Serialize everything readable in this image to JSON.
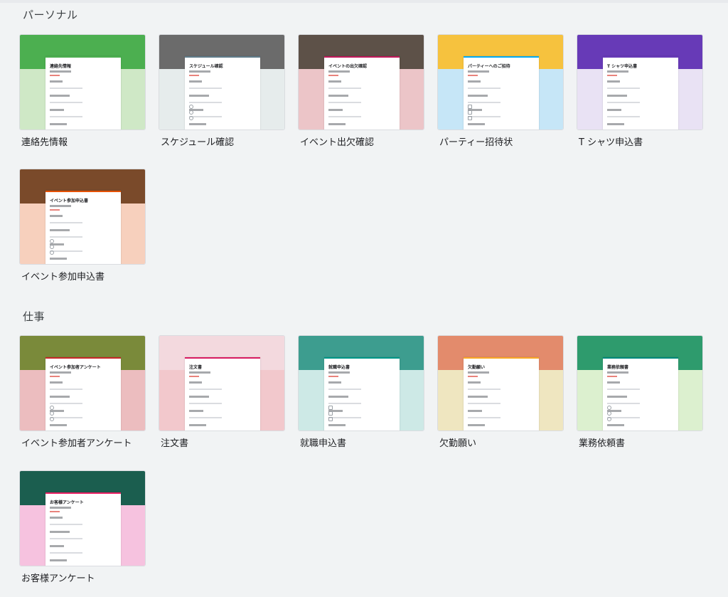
{
  "sections": [
    {
      "title": "パーソナル",
      "templates": [
        {
          "label": "連絡先情報",
          "form_title": "連絡先情報",
          "bg_color": "#cfe8c6",
          "header_color": "#4caf50",
          "accent": "#4caf50",
          "icon": "contact-form-thumbnail"
        },
        {
          "label": "スケジュール確認",
          "form_title": "スケジュール確認",
          "bg_color": "#e6ecec",
          "header_color": "#6b6b6b",
          "accent": "#607d8b",
          "icon": "schedule-form-thumbnail"
        },
        {
          "label": "イベント出欠確認",
          "form_title": "イベントの出欠確認",
          "bg_color": "#ecc5c8",
          "header_color": "#5d5148",
          "accent": "#c2185b",
          "icon": "rsvp-form-thumbnail"
        },
        {
          "label": "パーティー招待状",
          "form_title": "パーティーへのご招待",
          "bg_color": "#c6e6f7",
          "header_color": "#f6c23e",
          "accent": "#03a9f4",
          "icon": "party-form-thumbnail"
        },
        {
          "label": "T シャツ申込書",
          "form_title": "T シャツ申込書",
          "bg_color": "#e9e2f4",
          "header_color": "#673ab7",
          "accent": "#673ab7",
          "icon": "tshirt-form-thumbnail"
        },
        {
          "label": "イベント参加申込書",
          "form_title": "イベント参加申込書",
          "bg_color": "#f7d0bd",
          "header_color": "#7a4a2a",
          "accent": "#e65100",
          "icon": "event-registration-form-thumbnail"
        }
      ]
    },
    {
      "title": "仕事",
      "templates": [
        {
          "label": "イベント参加者アンケート",
          "form_title": "イベント参加者アンケート",
          "bg_color": "#ecbdbf",
          "header_color": "#7a8a3a",
          "accent": "#c62828",
          "icon": "event-feedback-form-thumbnail"
        },
        {
          "label": "注文書",
          "form_title": "注文書",
          "bg_color": "#f2c8cc",
          "header_color": "#f3d9de",
          "accent": "#d81b60",
          "icon": "order-form-thumbnail"
        },
        {
          "label": "就職申込書",
          "form_title": "就職申込書",
          "bg_color": "#cde9e6",
          "header_color": "#3d9d8f",
          "accent": "#009688",
          "icon": "job-application-form-thumbnail"
        },
        {
          "label": "欠勤願い",
          "form_title": "欠勤願い",
          "bg_color": "#efe6c0",
          "header_color": "#e38b6c",
          "accent": "#f9a825",
          "icon": "time-off-form-thumbnail"
        },
        {
          "label": "業務依頼書",
          "form_title": "業務依頼書",
          "bg_color": "#dcf0cf",
          "header_color": "#2e9b6d",
          "accent": "#00897b",
          "icon": "work-request-form-thumbnail"
        },
        {
          "label": "お客様アンケート",
          "form_title": "お客様アンケート",
          "bg_color": "#f6c2df",
          "header_color": "#1b5e4f",
          "accent": "#e91e63",
          "icon": "customer-feedback-form-thumbnail"
        }
      ]
    }
  ]
}
